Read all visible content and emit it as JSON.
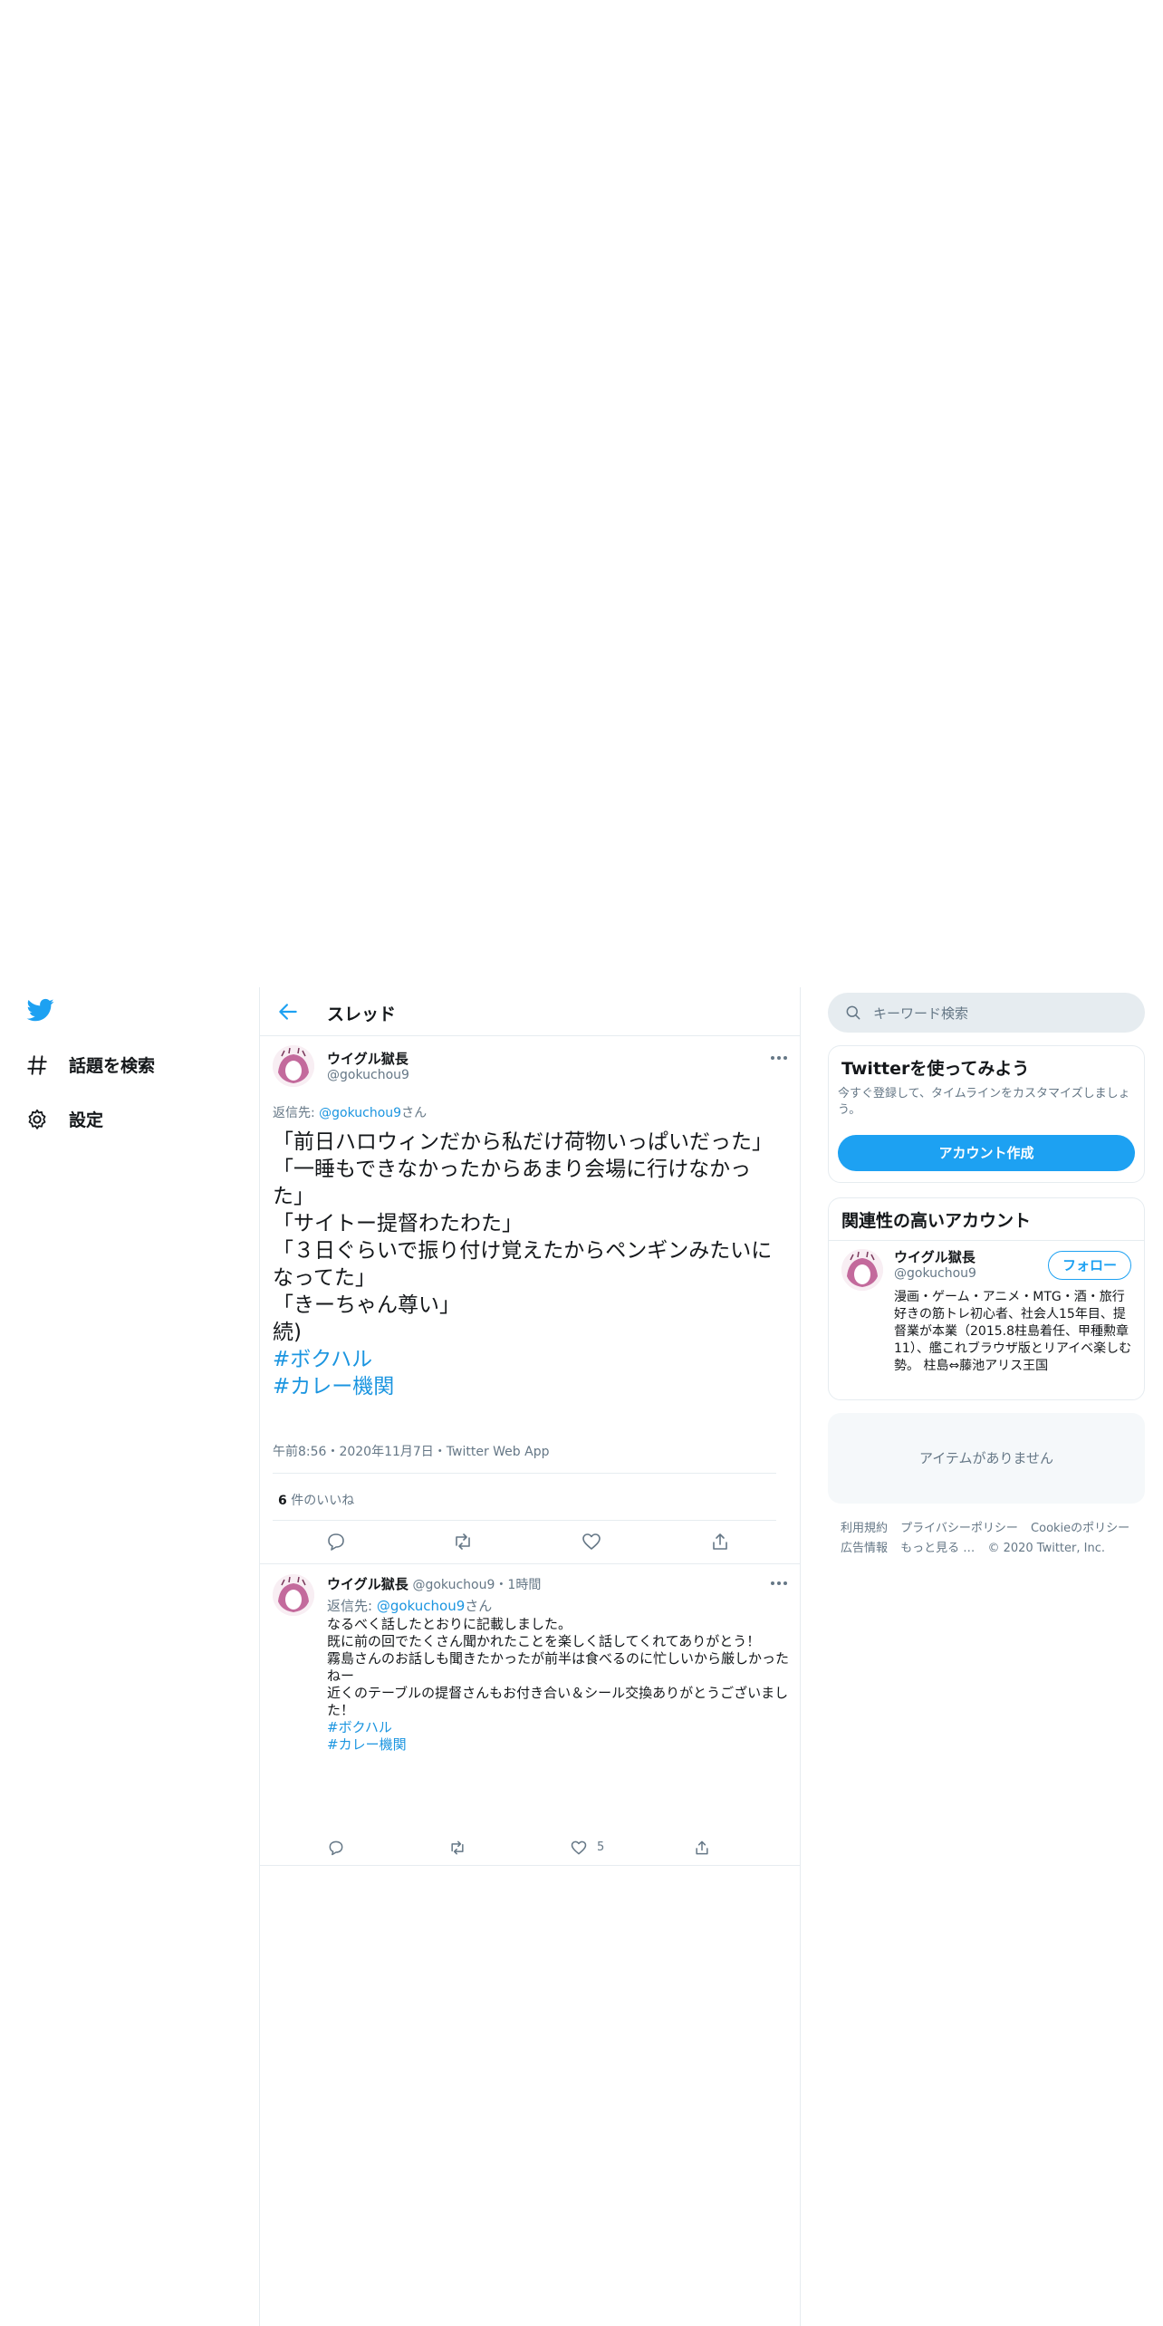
{
  "nav": {
    "logo_icon": "twitter-bird-icon",
    "items": [
      {
        "icon": "hashtag-icon",
        "label": "話題を検索"
      },
      {
        "icon": "gear-icon",
        "label": "設定"
      }
    ]
  },
  "header": {
    "title": "スレッド",
    "back_icon": "arrow-left-icon"
  },
  "main_tweet": {
    "name": "ウイグル獄長",
    "handle": "@gokuchou9",
    "reply_prefix": "返信先: ",
    "reply_to": "@gokuchou9",
    "reply_suffix": "さん",
    "text": "「前日ハロウィンだから私だけ荷物いっぱいだった」\n「一睡もできなかったからあまり会場に行けなかった」\n「サイトー提督わたわた」\n「３日ぐらいで振り付け覚えたからペンギンみたいになってた」\n「きーちゃん尊い」\n続)",
    "hashtags": [
      "#ボクハル",
      "#カレー機関"
    ],
    "meta": "午前8:56・2020年11月7日・Twitter Web App",
    "likes_count": "6",
    "likes_label": " 件のいいね"
  },
  "reply_tweet": {
    "name": "ウイグル獄長",
    "handle": "@gokuchou9",
    "time": "・1時間",
    "reply_prefix": "返信先: ",
    "reply_to": "@gokuchou9",
    "reply_suffix": "さん",
    "text": "なるべく話したとおりに記載しました。\n既に前の回でたくさん聞かれたことを楽しく話してくれてありがとう！\n霧島さんのお話しも聞きたかったが前半は食べるのに忙しいから厳しかったねー\n近くのテーブルの提督さんもお付き合い＆シール交換ありがとうございました！",
    "hashtags": [
      "#ボクハル",
      "#カレー機関"
    ],
    "like_count": "5"
  },
  "search": {
    "placeholder": "キーワード検索"
  },
  "signup_card": {
    "title": "Twitterを使ってみよう",
    "desc": "今すぐ登録して、タイムラインをカスタマイズしましょう。",
    "button": "アカウント作成"
  },
  "related_card": {
    "title": "関連性の高いアカウント",
    "name": "ウイグル獄長",
    "handle": "@gokuchou9",
    "follow": "フォロー",
    "bio": "漫画・ゲーム・アニメ・MTG・酒・旅行好きの筋トレ初心者、社会人15年目、提督業が本業（2015.8柱島着任、甲種勲章11）、艦これブラウザ版とリアイベ楽しむ勢。 柱島⇔藤池アリス王国"
  },
  "trends_empty": "アイテムがありません",
  "footer": {
    "line1": [
      "利用規約",
      "プライバシーポリシー",
      "Cookieのポリシー"
    ],
    "line2": [
      "広告情報",
      "もっと見る …",
      "© 2020 Twitter, Inc."
    ]
  },
  "colors": {
    "accent": "#1da1f2",
    "link": "#1b95e0",
    "muted": "#657786",
    "border": "#e6ecf0"
  }
}
